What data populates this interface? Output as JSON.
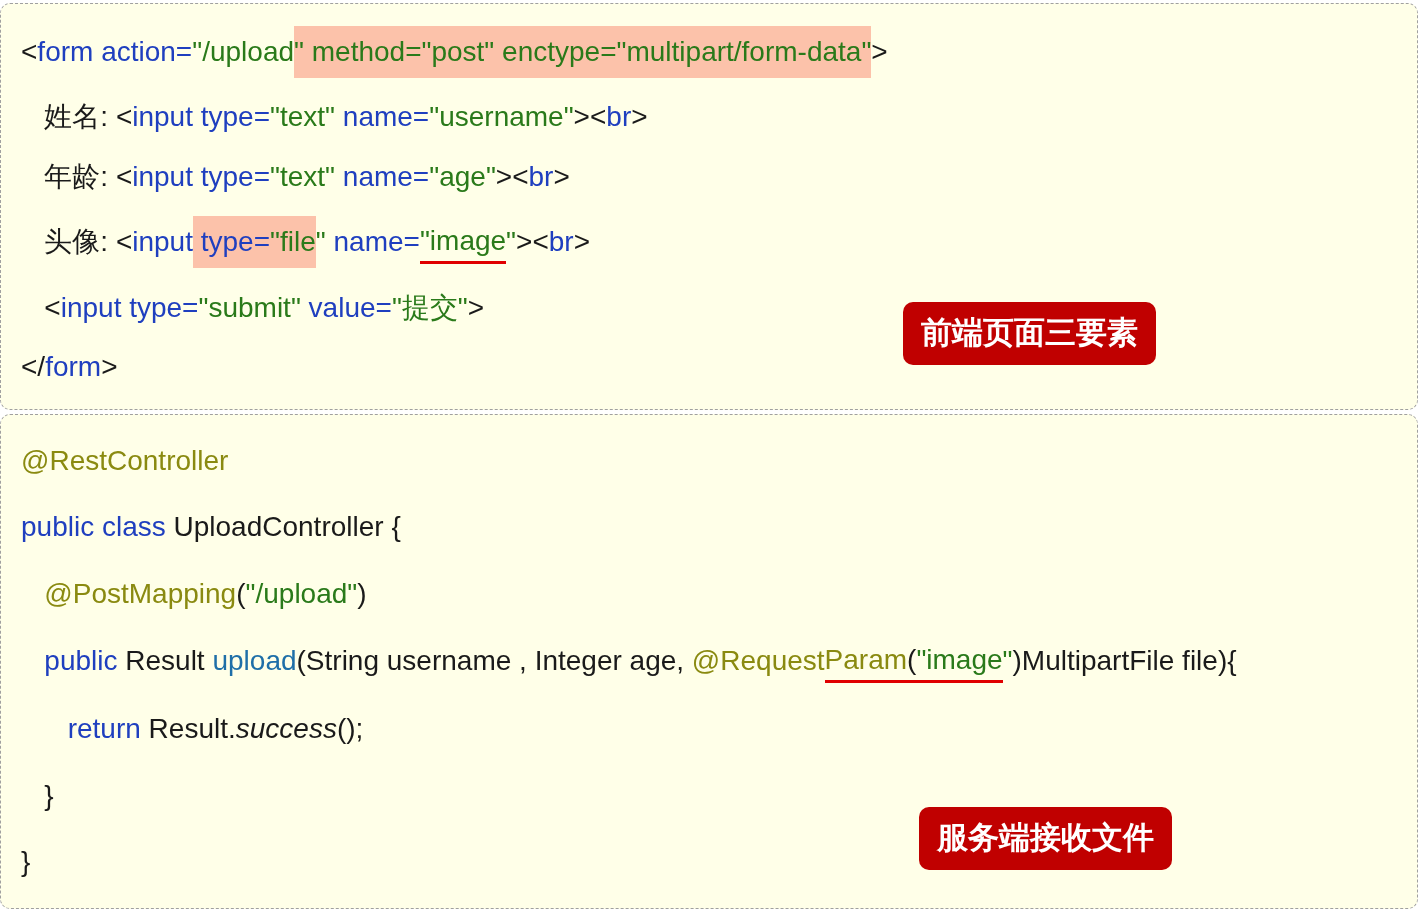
{
  "panels": [
    {
      "badge": "前端页面三要素",
      "lines": [
        [
          {
            "text": "<",
            "kind": "punct"
          },
          {
            "text": "form action=",
            "kind": "name"
          },
          {
            "text": "\"/upload",
            "kind": "string"
          },
          {
            "text": "\" method=\"post",
            "kind": "string",
            "highlight": true
          },
          {
            "text": "\" enctype=\"multipart/form-data\"",
            "kind": "string",
            "highlight": true
          },
          {
            "text": ">",
            "kind": "punct"
          }
        ],
        [
          {
            "text": "   姓名: <",
            "kind": "punct"
          },
          {
            "text": "input type=",
            "kind": "name"
          },
          {
            "text": "\"text\"",
            "kind": "string"
          },
          {
            "text": " name=",
            "kind": "name"
          },
          {
            "text": "\"username\"",
            "kind": "string"
          },
          {
            "text": "><",
            "kind": "punct"
          },
          {
            "text": "br",
            "kind": "name"
          },
          {
            "text": ">",
            "kind": "punct"
          }
        ],
        [
          {
            "text": "   年龄: <",
            "kind": "punct"
          },
          {
            "text": "input type=",
            "kind": "name"
          },
          {
            "text": "\"text\"",
            "kind": "string"
          },
          {
            "text": " name=",
            "kind": "name"
          },
          {
            "text": "\"age\"",
            "kind": "string"
          },
          {
            "text": "><",
            "kind": "punct"
          },
          {
            "text": "br",
            "kind": "name"
          },
          {
            "text": ">",
            "kind": "punct"
          }
        ],
        [
          {
            "text": "   头像: <",
            "kind": "punct"
          },
          {
            "text": "input",
            "kind": "name"
          },
          {
            "text": " type=",
            "kind": "name",
            "highlight": true
          },
          {
            "text": "\"file",
            "kind": "string",
            "highlight": true
          },
          {
            "text": "\"",
            "kind": "string"
          },
          {
            "text": " name=",
            "kind": "name"
          },
          {
            "text": "\"image",
            "kind": "string",
            "underline": true
          },
          {
            "text": "\"",
            "kind": "string"
          },
          {
            "text": "><",
            "kind": "punct"
          },
          {
            "text": "br",
            "kind": "name"
          },
          {
            "text": ">",
            "kind": "punct"
          }
        ],
        [
          {
            "text": "   <",
            "kind": "punct"
          },
          {
            "text": "input type=",
            "kind": "name"
          },
          {
            "text": "\"submit\"",
            "kind": "string"
          },
          {
            "text": " value=",
            "kind": "name"
          },
          {
            "text": "\"提交\"",
            "kind": "string"
          },
          {
            "text": ">",
            "kind": "punct"
          }
        ],
        [
          {
            "text": "</",
            "kind": "punct"
          },
          {
            "text": "form",
            "kind": "name"
          },
          {
            "text": ">",
            "kind": "punct"
          }
        ]
      ]
    },
    {
      "badge": "服务端接收文件",
      "lines": [
        [
          {
            "text": "@RestController",
            "kind": "annotation"
          }
        ],
        [
          {
            "text": "public class",
            "kind": "keyword"
          },
          {
            "text": " UploadController {",
            "kind": "plain"
          }
        ],
        [
          {
            "text": "   @PostMapping",
            "kind": "annotation"
          },
          {
            "text": "(",
            "kind": "plain"
          },
          {
            "text": "\"/upload\"",
            "kind": "string"
          },
          {
            "text": ")",
            "kind": "plain"
          }
        ],
        [
          {
            "text": "   public",
            "kind": "keyword"
          },
          {
            "text": " Result ",
            "kind": "plain"
          },
          {
            "text": "upload",
            "kind": "method"
          },
          {
            "text": "(String username , Integer age, ",
            "kind": "plain"
          },
          {
            "text": "@Request",
            "kind": "annotation"
          },
          {
            "text": "Param",
            "kind": "annotation",
            "underline": true
          },
          {
            "text": "(",
            "kind": "plain",
            "underline": true
          },
          {
            "text": "\"image",
            "kind": "string",
            "underline": true
          },
          {
            "text": "\"",
            "kind": "string"
          },
          {
            "text": ")MultipartFile file){",
            "kind": "plain"
          }
        ],
        [
          {
            "text": "      return",
            "kind": "keyword"
          },
          {
            "text": " Result.",
            "kind": "plain"
          },
          {
            "text": "success",
            "kind": "italic"
          },
          {
            "text": "();",
            "kind": "plain"
          }
        ],
        [
          {
            "text": "   }",
            "kind": "plain"
          }
        ],
        [
          {
            "text": "}",
            "kind": "plain"
          }
        ]
      ]
    }
  ]
}
